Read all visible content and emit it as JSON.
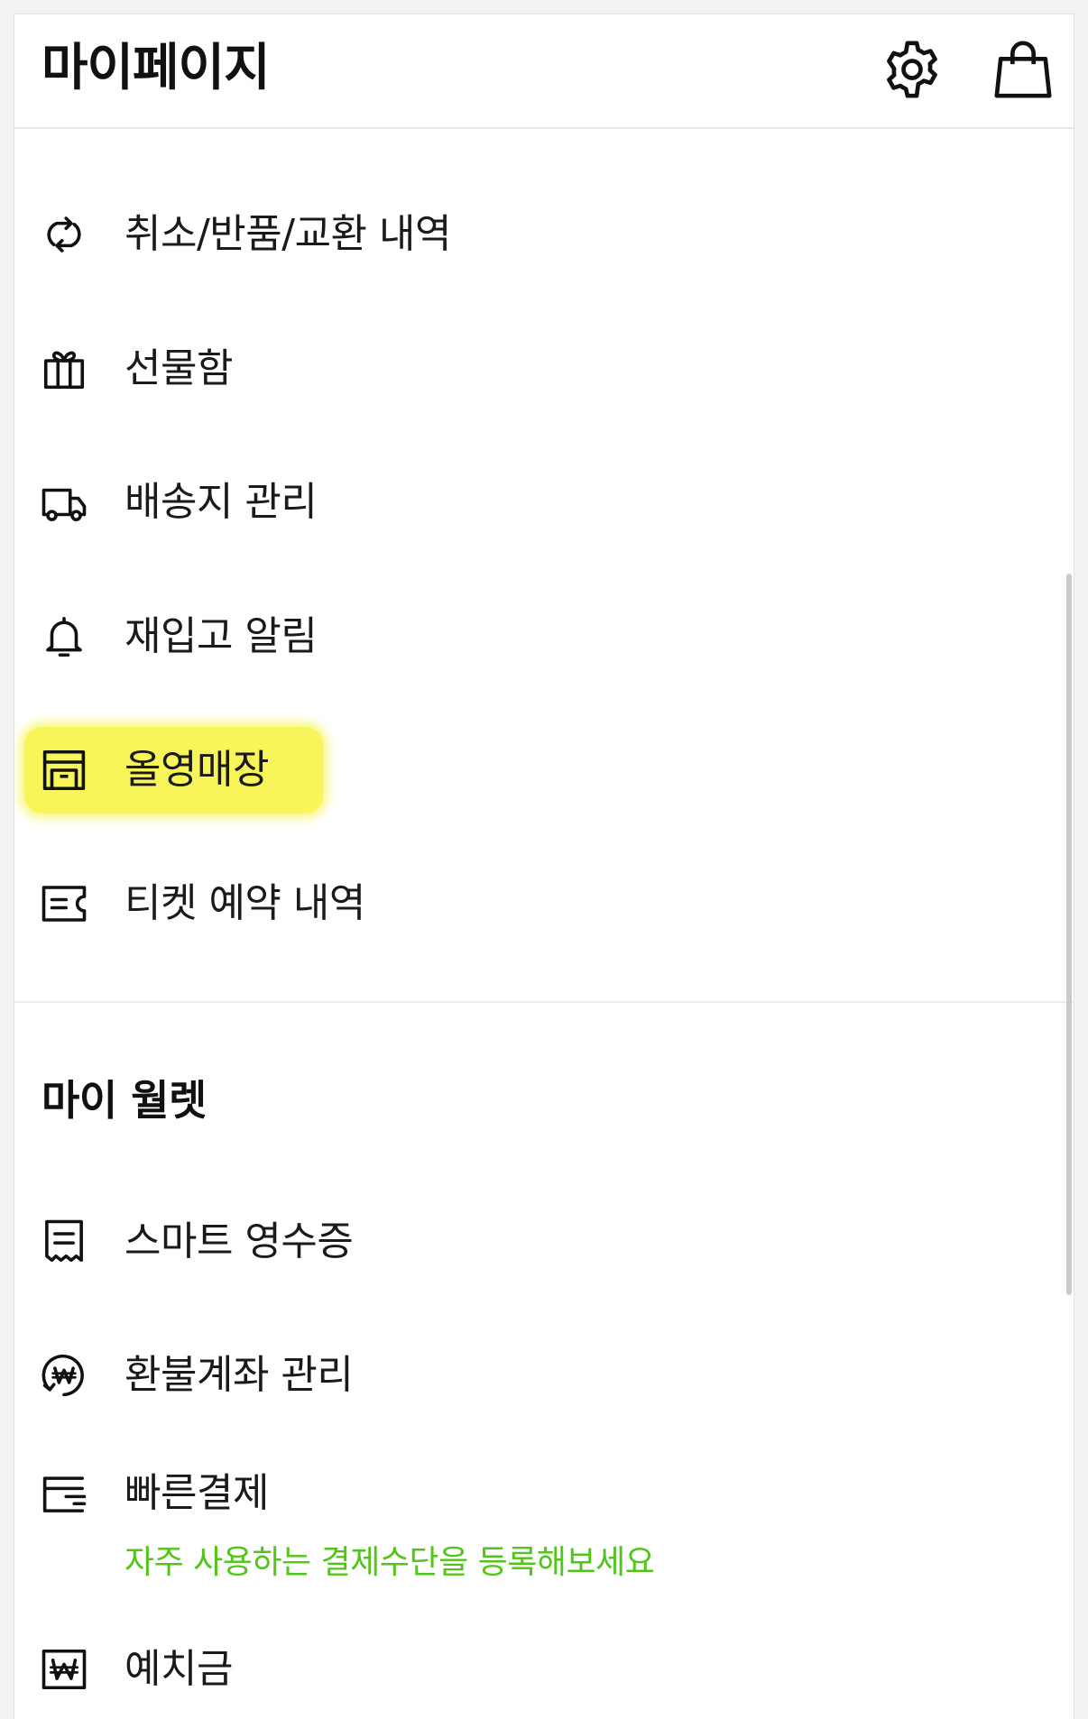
{
  "header": {
    "title": "마이페이지",
    "settings_icon": "gear-icon",
    "cart_icon": "shopping-bag-icon"
  },
  "menu": {
    "items": [
      {
        "label": "취소/반품/교환 내역",
        "icon": "refresh-arrows-icon"
      },
      {
        "label": "선물함",
        "icon": "gift-icon"
      },
      {
        "label": "배송지 관리",
        "icon": "truck-icon"
      },
      {
        "label": "재입고 알림",
        "icon": "bell-icon"
      },
      {
        "label": "올영매장",
        "icon": "store-icon",
        "highlighted": true
      },
      {
        "label": "티켓 예약 내역",
        "icon": "ticket-icon"
      }
    ]
  },
  "wallet": {
    "title": "마이 월렛",
    "items": [
      {
        "label": "스마트 영수증",
        "icon": "receipt-icon"
      },
      {
        "label": "환불계좌 관리",
        "icon": "refund-won-icon"
      },
      {
        "label": "빠른결제",
        "icon": "card-icon",
        "sublabel": "자주 사용하는 결제수단을 등록해보세요"
      },
      {
        "label": "예치금",
        "icon": "won-box-icon"
      }
    ]
  },
  "colors": {
    "highlight": "#f7f55a",
    "sublabel": "#52c41a",
    "text": "#1a1a1a"
  }
}
